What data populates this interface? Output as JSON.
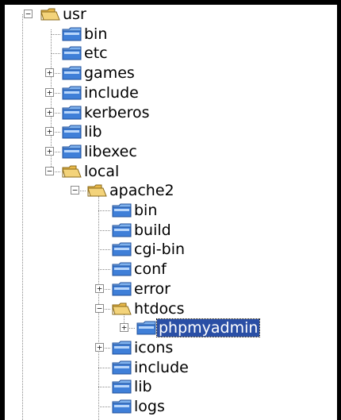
{
  "tree": {
    "nodes": [
      {
        "label": "usr",
        "icon": "folder-open-icon",
        "expander": "minus"
      },
      {
        "label": "bin",
        "icon": "folder-closed-icon",
        "expander": "none"
      },
      {
        "label": "etc",
        "icon": "folder-closed-icon",
        "expander": "none"
      },
      {
        "label": "games",
        "icon": "folder-closed-icon",
        "expander": "plus"
      },
      {
        "label": "include",
        "icon": "folder-closed-icon",
        "expander": "plus"
      },
      {
        "label": "kerberos",
        "icon": "folder-closed-icon",
        "expander": "plus"
      },
      {
        "label": "lib",
        "icon": "folder-closed-icon",
        "expander": "plus"
      },
      {
        "label": "libexec",
        "icon": "folder-closed-icon",
        "expander": "plus"
      },
      {
        "label": "local",
        "icon": "folder-open-icon",
        "expander": "minus"
      },
      {
        "label": "apache2",
        "icon": "folder-open-icon",
        "expander": "minus"
      },
      {
        "label": "bin",
        "icon": "folder-closed-icon",
        "expander": "none"
      },
      {
        "label": "build",
        "icon": "folder-closed-icon",
        "expander": "none"
      },
      {
        "label": "cgi-bin",
        "icon": "folder-closed-icon",
        "expander": "none"
      },
      {
        "label": "conf",
        "icon": "folder-closed-icon",
        "expander": "none"
      },
      {
        "label": "error",
        "icon": "folder-closed-icon",
        "expander": "plus"
      },
      {
        "label": "htdocs",
        "icon": "folder-open-icon",
        "expander": "minus"
      },
      {
        "label": "phpmyadmin",
        "icon": "folder-closed-icon",
        "expander": "plus",
        "selected": true
      },
      {
        "label": "icons",
        "icon": "folder-closed-icon",
        "expander": "plus"
      },
      {
        "label": "include",
        "icon": "folder-closed-icon",
        "expander": "none"
      },
      {
        "label": "lib",
        "icon": "folder-closed-icon",
        "expander": "none"
      },
      {
        "label": "logs",
        "icon": "folder-closed-icon",
        "expander": "none"
      }
    ]
  },
  "colors": {
    "selection": "#2a4fa5",
    "folder_blue": "#3f7fd8",
    "folder_yellow": "#f3d37a"
  }
}
